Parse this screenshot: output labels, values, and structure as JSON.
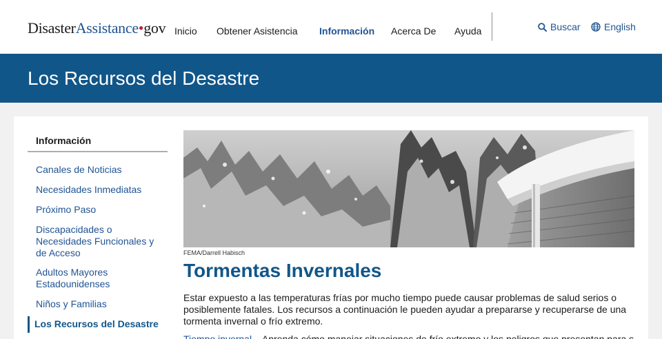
{
  "header": {
    "logo": {
      "part1": "Disaster",
      "part2": "Assistance",
      "dot": "•",
      "part3": "gov"
    },
    "nav": [
      {
        "label": "Inicio",
        "active": false
      },
      {
        "label": "Obtener Asistencia",
        "active": false
      },
      {
        "label": "Información",
        "active": true
      },
      {
        "label": "Acerca De",
        "active": false
      },
      {
        "label": "Ayuda",
        "active": false
      }
    ],
    "search_label": "Buscar",
    "language_label": "English"
  },
  "banner": {
    "title": "Los Recursos del Desastre"
  },
  "sidebar": {
    "heading": "Información",
    "items": [
      {
        "label": "Canales de Noticias"
      },
      {
        "label": "Necesidades Inmediatas"
      },
      {
        "label": "Próximo Paso"
      },
      {
        "label": "Discapacidades o Necesidades Funcionales y de Acceso"
      },
      {
        "label": "Adultos Mayores Estadounidenses"
      },
      {
        "label": "Niños y Familias"
      },
      {
        "label": "Los Recursos del Desastre",
        "current": true
      }
    ]
  },
  "main": {
    "photo_credit": "FEMA/Darrell Habisch",
    "title": "Tormentas Invernales",
    "paragraph": "Estar expuesto a las temperaturas frías por mucho tiempo puede causar problemas de salud serios o posiblemente fatales. Los recursos a continuación le pueden ayudar a prepararse y recuperarse de una tormenta invernal o frío extremo.",
    "link_label": "Tiempo invernal",
    "link_desc": " – Aprenda cómo manejar situaciones de frío extremo y los peligros que presentan para su"
  },
  "colors": {
    "brand_blue": "#115689",
    "link_blue": "#205493",
    "logo_red": "#c41f3e"
  }
}
